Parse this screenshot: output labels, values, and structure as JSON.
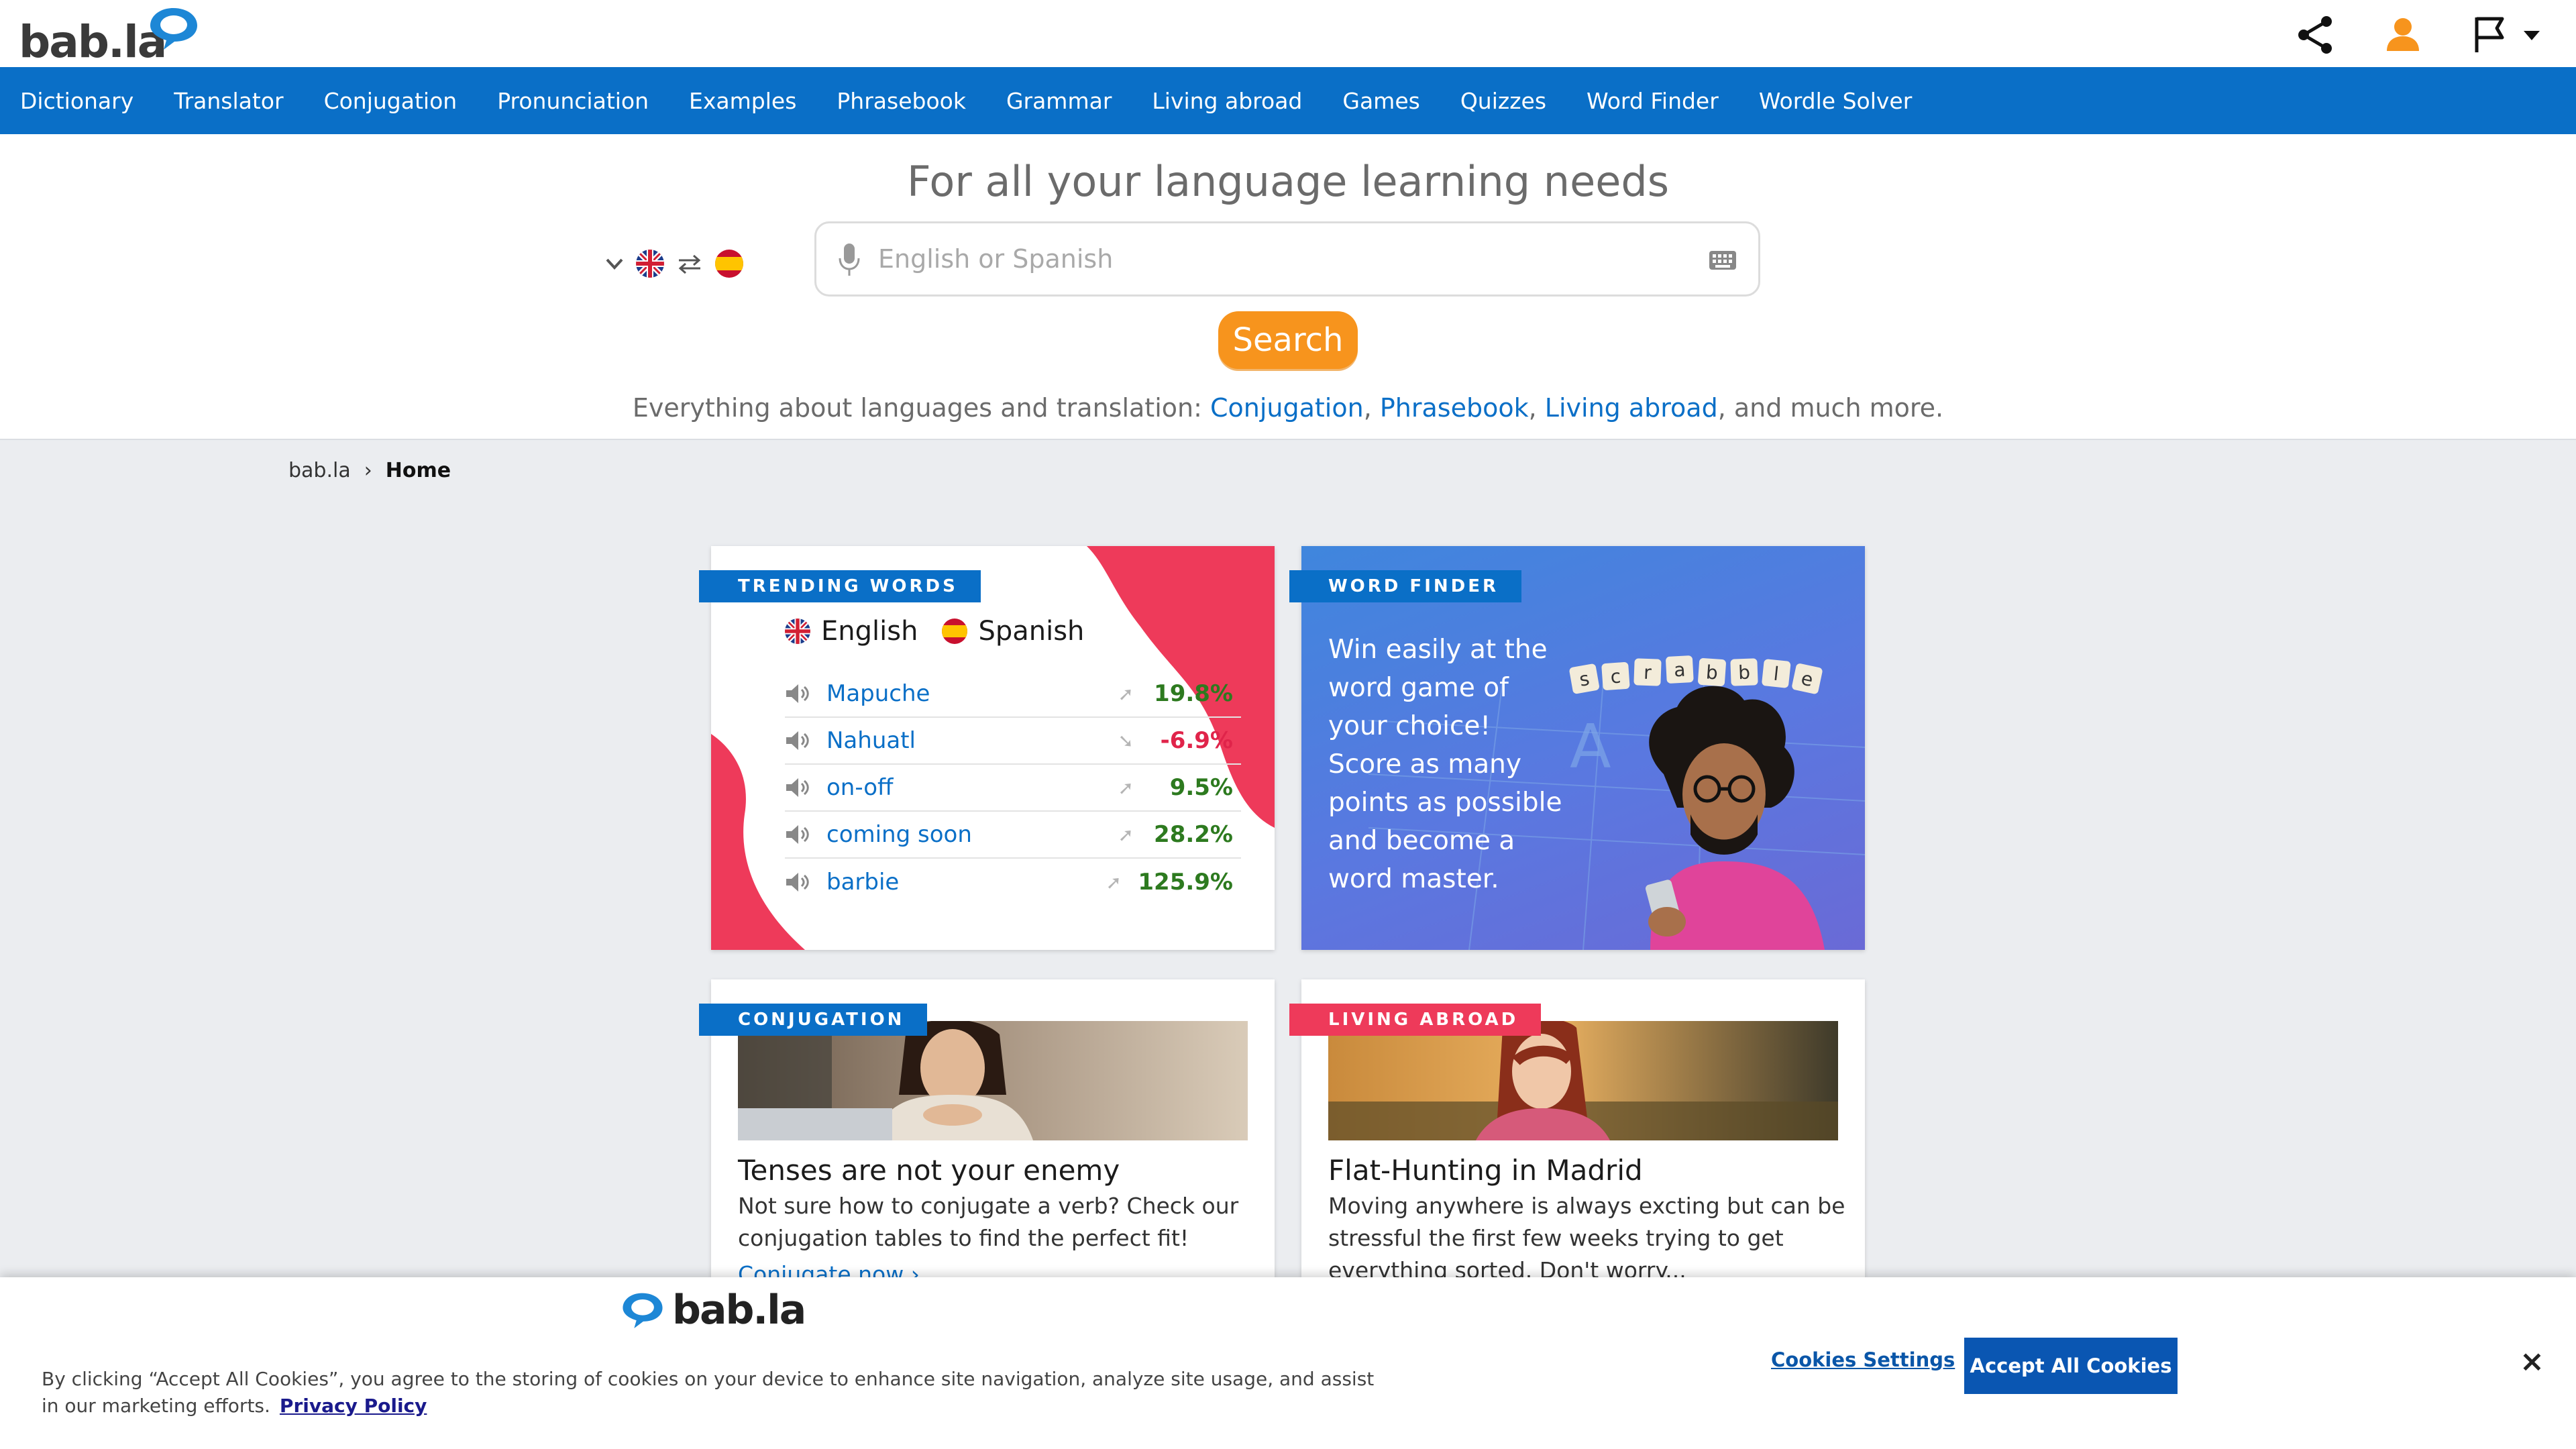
{
  "brand": {
    "logo_text": "bab.la"
  },
  "nav": [
    "Dictionary",
    "Translator",
    "Conjugation",
    "Pronunciation",
    "Examples",
    "Phrasebook",
    "Grammar",
    "Living abroad",
    "Games",
    "Quizzes",
    "Word Finder",
    "Wordle Solver"
  ],
  "hero": {
    "title": "For all your language learning needs",
    "search_placeholder": "English or Spanish",
    "search_button": "Search",
    "subtitle_prefix": "Everything about languages and translation:",
    "subtitle_link1": "Conjugation",
    "subtitle_link2": "Phrasebook",
    "subtitle_link3": "Living abroad",
    "subtitle_suffix": ", and much more.",
    "sep": ","
  },
  "breadcrumb": {
    "root": "bab.la",
    "separator": "›",
    "current": "Home"
  },
  "trending": {
    "tag": "TRENDING WORDS",
    "lang_a": "English",
    "lang_b": "Spanish",
    "rows": [
      {
        "word": "Mapuche",
        "change": "19.8%",
        "trend": "up"
      },
      {
        "word": "Nahuatl",
        "change": "-6.9%",
        "trend": "down"
      },
      {
        "word": "on-off",
        "change": "9.5%",
        "trend": "up"
      },
      {
        "word": "coming soon",
        "change": "28.2%",
        "trend": "up"
      },
      {
        "word": "barbie",
        "change": "125.9%",
        "trend": "up"
      }
    ]
  },
  "word_finder": {
    "tag": "WORD FINDER",
    "text": "Win easily at the word game of your choice! Score as many points as possible and become a word master.",
    "tiles": [
      "s",
      "c",
      "r",
      "a",
      "b",
      "b",
      "l",
      "e"
    ]
  },
  "conjugation": {
    "tag": "CONJUGATION",
    "title": "Tenses are not your enemy",
    "text": "Not sure how to conjugate a verb? Check our conjugation tables to find the perfect fit!",
    "link": "Conjugate now ›"
  },
  "living_abroad": {
    "tag": "LIVING ABROAD",
    "title": "Flat-Hunting in Madrid",
    "text": "Moving anywhere is always excting but can be stressful the first few weeks trying to get everything sorted. Don't worry..."
  },
  "cookie": {
    "text": "By clicking “Accept All Cookies”, you agree to the storing of cookies on your device to enhance site navigation, analyze site usage, and assist in our marketing efforts.",
    "privacy": "Privacy Policy",
    "settings": "Cookies Settings",
    "accept": "Accept All Cookies",
    "close": "×"
  },
  "colors": {
    "brand_blue": "#0a6fc7",
    "accent_orange": "#f7941d",
    "accent_red": "#ee3a5a",
    "up_green": "#2d7a1f",
    "down_red": "#e0244a"
  }
}
